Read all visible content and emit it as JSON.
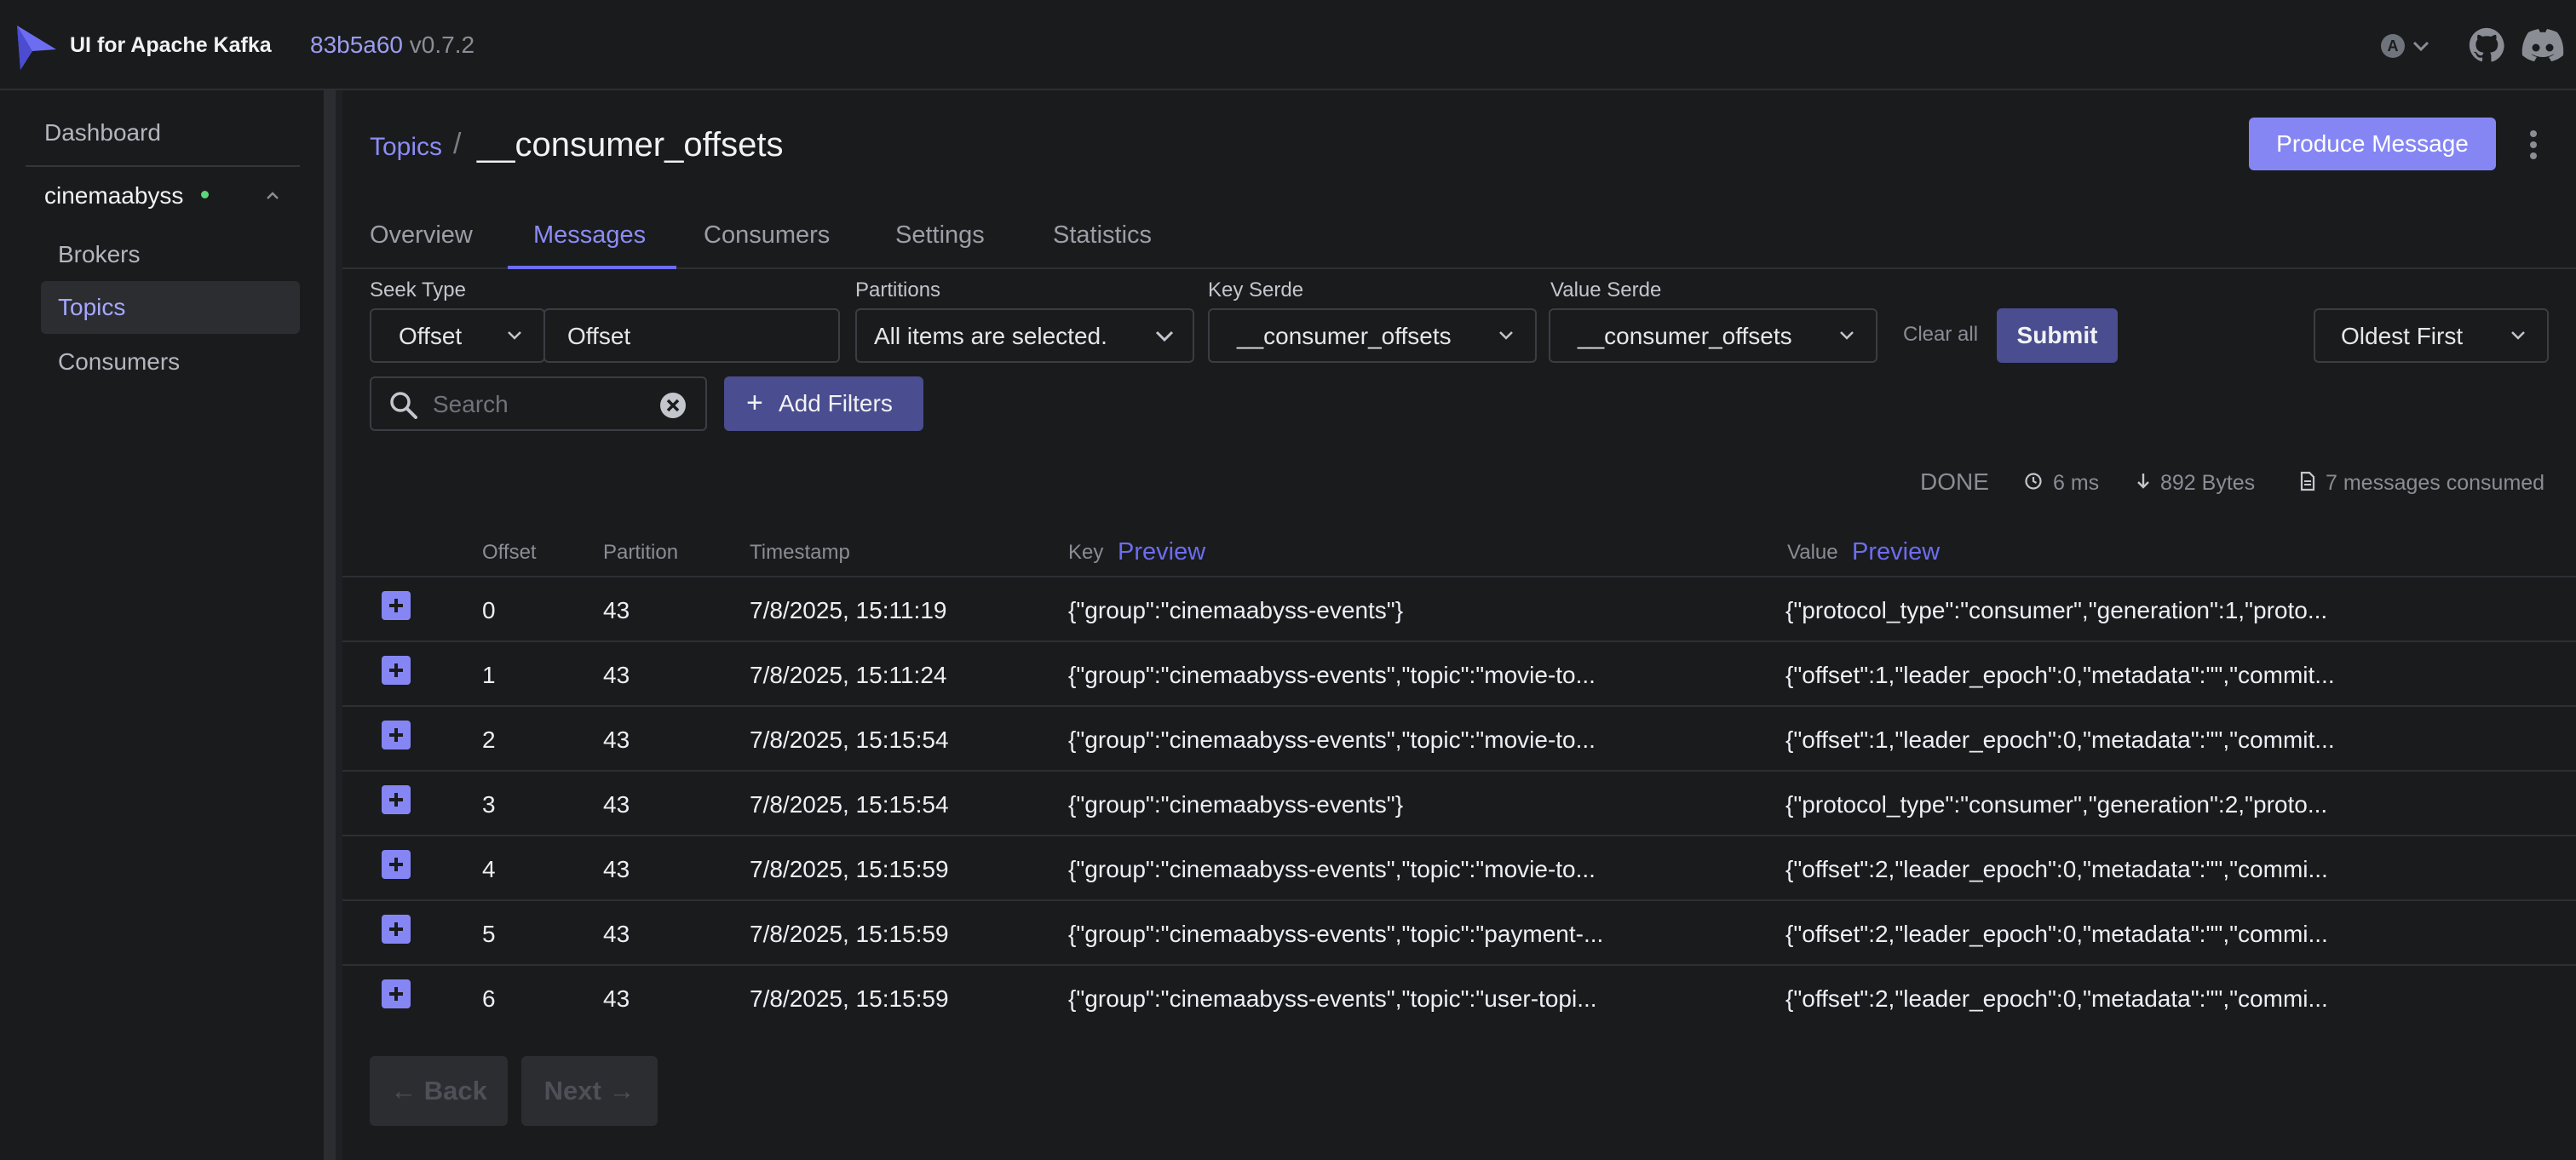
{
  "header": {
    "brand": "UI for Apache Kafka",
    "version_hash": "83b5a60",
    "version_number": "v0.7.2",
    "icons": [
      "kafka-logo-icon",
      "theme-auto-icon",
      "github-icon",
      "discord-icon"
    ]
  },
  "sidebar": {
    "dashboard": "Dashboard",
    "cluster": "cinemaabyss",
    "cluster_status_color": "#5bd67a",
    "items": [
      {
        "label": "Brokers"
      },
      {
        "label": "Topics"
      },
      {
        "label": "Consumers"
      }
    ]
  },
  "breadcrumb": {
    "parent": "Topics",
    "separator": "/",
    "current": "__consumer_offsets"
  },
  "actions": {
    "produce": "Produce Message"
  },
  "tabs": [
    {
      "label": "Overview"
    },
    {
      "label": "Messages"
    },
    {
      "label": "Consumers"
    },
    {
      "label": "Settings"
    },
    {
      "label": "Statistics"
    }
  ],
  "filters": {
    "seek_type_label": "Seek Type",
    "seek_type_value": "Offset",
    "offset_value": "Offset",
    "partitions_label": "Partitions",
    "partitions_value": "All items are selected.",
    "key_serde_label": "Key Serde",
    "key_serde_value": "__consumer_offsets",
    "value_serde_label": "Value Serde",
    "value_serde_value": "__consumer_offsets",
    "clear_all": "Clear all",
    "submit": "Submit",
    "sort_value": "Oldest First",
    "search_placeholder": "Search",
    "add_filters": "Add Filters"
  },
  "stats": {
    "status": "DONE",
    "elapsed": "6 ms",
    "bytes": "892 Bytes",
    "consumed": "7 messages consumed"
  },
  "table": {
    "headers": {
      "offset": "Offset",
      "partition": "Partition",
      "timestamp": "Timestamp",
      "key": "Key",
      "value": "Value",
      "preview": "Preview"
    },
    "rows": [
      {
        "offset": "0",
        "partition": "43",
        "timestamp": "7/8/2025, 15:11:19",
        "key": "{\"group\":\"cinemaabyss-events\"}",
        "value": "{\"protocol_type\":\"consumer\",\"generation\":1,\"proto..."
      },
      {
        "offset": "1",
        "partition": "43",
        "timestamp": "7/8/2025, 15:11:24",
        "key": "{\"group\":\"cinemaabyss-events\",\"topic\":\"movie-to...",
        "value": "{\"offset\":1,\"leader_epoch\":0,\"metadata\":\"\",\"commit..."
      },
      {
        "offset": "2",
        "partition": "43",
        "timestamp": "7/8/2025, 15:15:54",
        "key": "{\"group\":\"cinemaabyss-events\",\"topic\":\"movie-to...",
        "value": "{\"offset\":1,\"leader_epoch\":0,\"metadata\":\"\",\"commit..."
      },
      {
        "offset": "3",
        "partition": "43",
        "timestamp": "7/8/2025, 15:15:54",
        "key": "{\"group\":\"cinemaabyss-events\"}",
        "value": "{\"protocol_type\":\"consumer\",\"generation\":2,\"proto..."
      },
      {
        "offset": "4",
        "partition": "43",
        "timestamp": "7/8/2025, 15:15:59",
        "key": "{\"group\":\"cinemaabyss-events\",\"topic\":\"movie-to...",
        "value": "{\"offset\":2,\"leader_epoch\":0,\"metadata\":\"\",\"commi..."
      },
      {
        "offset": "5",
        "partition": "43",
        "timestamp": "7/8/2025, 15:15:59",
        "key": "{\"group\":\"cinemaabyss-events\",\"topic\":\"payment-...",
        "value": "{\"offset\":2,\"leader_epoch\":0,\"metadata\":\"\",\"commi..."
      },
      {
        "offset": "6",
        "partition": "43",
        "timestamp": "7/8/2025, 15:15:59",
        "key": "{\"group\":\"cinemaabyss-events\",\"topic\":\"user-topi...",
        "value": "{\"offset\":2,\"leader_epoch\":0,\"metadata\":\"\",\"commi..."
      }
    ]
  },
  "pagination": {
    "back": "← Back",
    "next": "Next →"
  },
  "colors": {
    "accent": "#8586f4",
    "accent_dark": "#4a4d8f",
    "background": "#1a1b1d"
  }
}
